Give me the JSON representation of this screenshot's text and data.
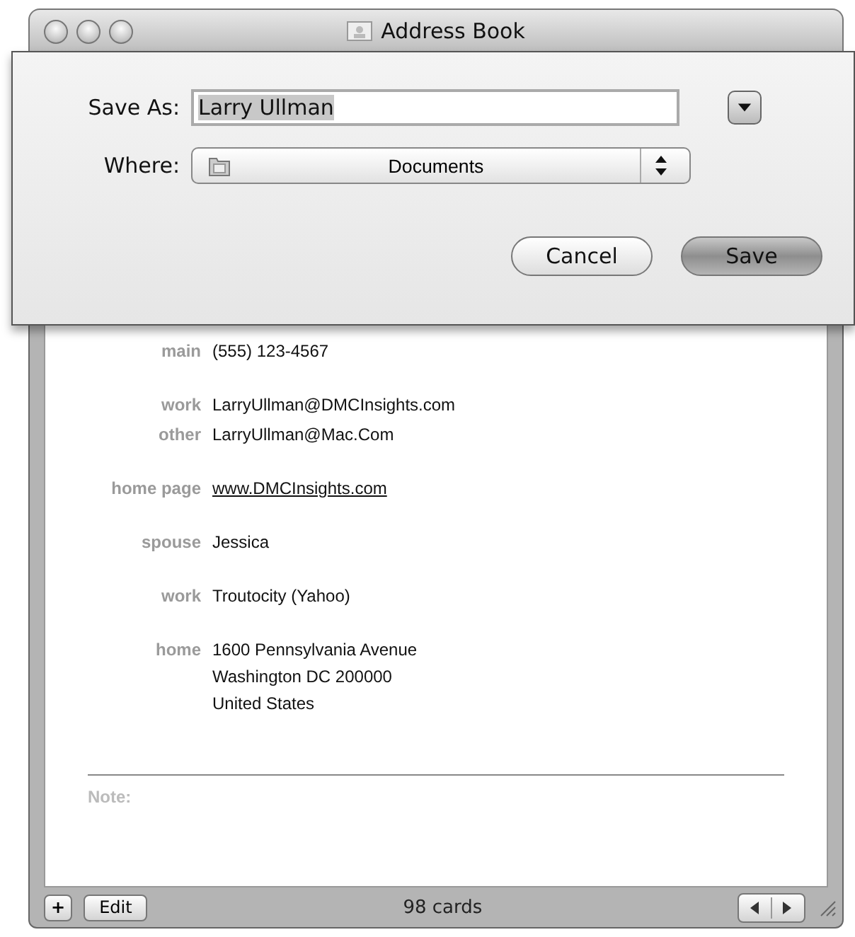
{
  "window": {
    "title": "Address Book"
  },
  "save_sheet": {
    "save_as_label": "Save As:",
    "save_as_value": "Larry Ullman",
    "value_selected": true,
    "where_label": "Where:",
    "where_value": "Documents",
    "buttons": [
      {
        "label": "Cancel",
        "default": false
      },
      {
        "label": "Save",
        "default": true
      }
    ]
  },
  "card": {
    "groups": [
      {
        "rows": [
          {
            "label": "main",
            "kind": "text",
            "lines": [
              "(555) 123-4567"
            ]
          }
        ]
      },
      {
        "rows": [
          {
            "label": "work",
            "kind": "text",
            "lines": [
              "LarryUllman@DMCInsights.com"
            ]
          },
          {
            "label": "other",
            "kind": "text",
            "lines": [
              "LarryUllman@Mac.Com"
            ]
          }
        ]
      },
      {
        "rows": [
          {
            "label": "home page",
            "kind": "link",
            "lines": [
              "www.DMCInsights.com"
            ]
          }
        ]
      },
      {
        "rows": [
          {
            "label": "spouse",
            "kind": "text",
            "lines": [
              "Jessica"
            ]
          }
        ]
      },
      {
        "rows": [
          {
            "label": "work",
            "kind": "text",
            "lines": [
              "Troutocity (Yahoo)"
            ]
          }
        ]
      },
      {
        "rows": [
          {
            "label": "home",
            "kind": "text",
            "lines": [
              "1600 Pennsylvania Avenue",
              "Washington DC 200000",
              "United States"
            ]
          }
        ]
      }
    ],
    "note_label": "Note:"
  },
  "bottom_bar": {
    "add_button": "+",
    "edit_button": "Edit",
    "count": "98 cards"
  }
}
